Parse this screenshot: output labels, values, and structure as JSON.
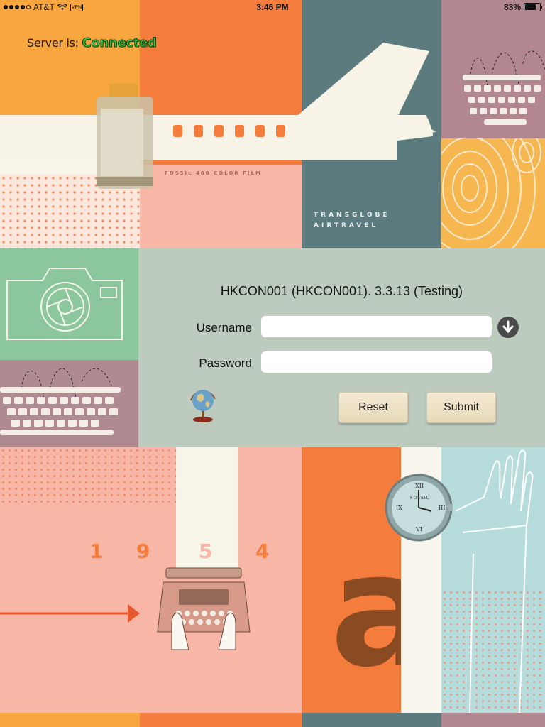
{
  "status_bar": {
    "carrier": "AT&T",
    "vpn_label": "VPN",
    "time": "3:46 PM",
    "battery_percent": "83%",
    "battery_level": 0.83
  },
  "server_status": {
    "label": "Server is:",
    "value": "Connected",
    "value_color": "#36c23a"
  },
  "background": {
    "film_caption": "FOSSIL 400 COLOR FILM",
    "airline_line1": "TRANSGLOBE",
    "airline_line2": "AIRTRAVEL",
    "year_digits": [
      "1",
      "9",
      "5",
      "4"
    ],
    "watch_brand": "FOSSIL",
    "big_letter": "a"
  },
  "login": {
    "title": "HKCON001 (HKCON001). 3.3.13 (Testing)",
    "username_label": "Username",
    "username_value": "",
    "password_label": "Password",
    "password_value": "",
    "reset_label": "Reset",
    "submit_label": "Submit"
  },
  "colors": {
    "accent_orange": "#f47c3c",
    "panel_bg": "#bdcbbf",
    "connected_green": "#36c23a"
  }
}
